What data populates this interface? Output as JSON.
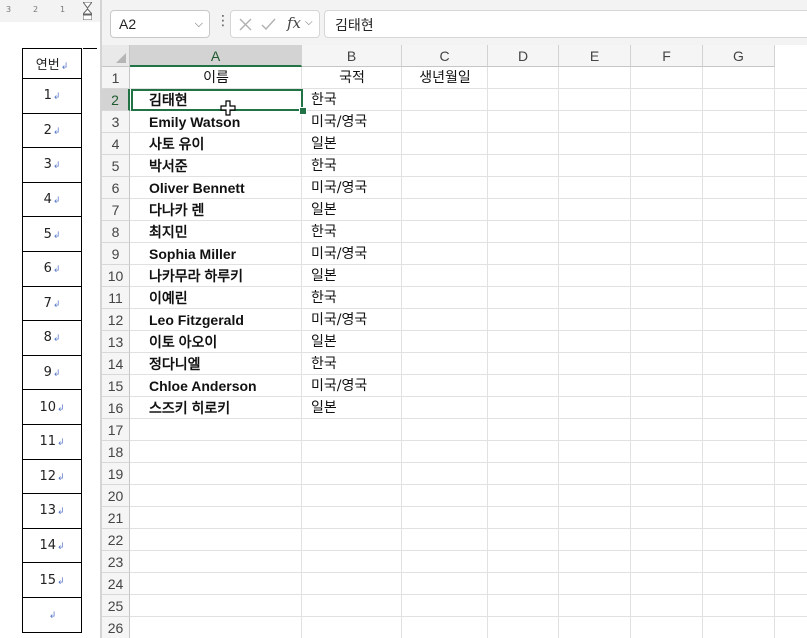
{
  "word_doc": {
    "ruler_ticks": [
      "3",
      "2",
      "1"
    ],
    "table_header": "연번",
    "paragraph_mark": "↲",
    "rows": [
      "1",
      "2",
      "3",
      "4",
      "5",
      "6",
      "7",
      "8",
      "9",
      "10",
      "11",
      "12",
      "13",
      "14",
      "15",
      ""
    ]
  },
  "excel": {
    "name_box": "A2",
    "fx_label": "fx",
    "formula_value": "김태현",
    "columns": [
      "A",
      "B",
      "C",
      "D",
      "E",
      "F",
      "G"
    ],
    "selected_column": "A",
    "selected_row": "2",
    "row_numbers": [
      "1",
      "2",
      "3",
      "4",
      "5",
      "6",
      "7",
      "8",
      "9",
      "10",
      "11",
      "12",
      "13",
      "14",
      "15",
      "16",
      "17",
      "18",
      "19",
      "20",
      "21",
      "22",
      "23",
      "24",
      "25",
      "26"
    ],
    "header_row": {
      "a": "이름",
      "b": "국적",
      "c": "생년월일"
    },
    "rows": [
      {
        "name": "김태현",
        "nationality": "한국"
      },
      {
        "name": "Emily Watson",
        "nationality": "미국/영국"
      },
      {
        "name": "사토 유이",
        "nationality": "일본"
      },
      {
        "name": "박서준",
        "nationality": "한국"
      },
      {
        "name": "Oliver Bennett",
        "nationality": "미국/영국"
      },
      {
        "name": "다나카 렌",
        "nationality": "일본"
      },
      {
        "name": "최지민",
        "nationality": "한국"
      },
      {
        "name": "Sophia Miller",
        "nationality": "미국/영국"
      },
      {
        "name": "나카무라 하루키",
        "nationality": "일본"
      },
      {
        "name": "이예린",
        "nationality": "한국"
      },
      {
        "name": "Leo Fitzgerald",
        "nationality": "미국/영국"
      },
      {
        "name": "이토 아오이",
        "nationality": "일본"
      },
      {
        "name": "정다니엘",
        "nationality": "한국"
      },
      {
        "name": "Chloe Anderson",
        "nationality": "미국/영국"
      },
      {
        "name": "스즈키 히로키",
        "nationality": "일본"
      }
    ],
    "accent_color": "#217346"
  }
}
